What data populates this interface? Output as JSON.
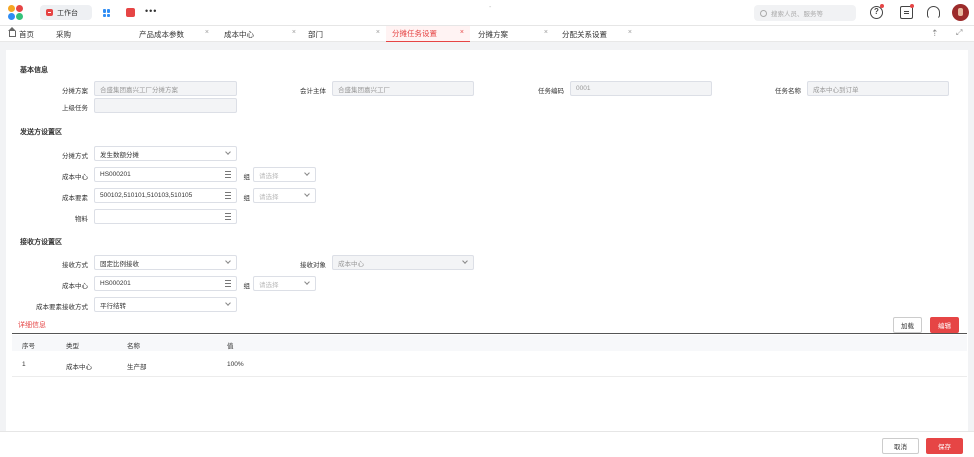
{
  "topbar": {
    "workbench_label": "工作台",
    "more_label": "•••",
    "center_mark": "-",
    "search_placeholder": "搜索人员、服务等"
  },
  "tabs": [
    {
      "label": "首页",
      "closable": false
    },
    {
      "label": "采购",
      "closable": false
    },
    {
      "label": "产品成本参数",
      "closable": true
    },
    {
      "label": "成本中心",
      "closable": true
    },
    {
      "label": "部门",
      "closable": true
    },
    {
      "label": "分摊任务设置",
      "closable": true,
      "active": true
    },
    {
      "label": "分摊方案",
      "closable": true
    },
    {
      "label": "分配关系设置",
      "closable": true
    }
  ],
  "basic": {
    "title": "基本信息",
    "scheme_label": "分摊方案",
    "scheme_value": "合盛集团嘉兴工厂分摊方案",
    "entity_label": "会计主体",
    "entity_value": "合盛集团嘉兴工厂",
    "code_label": "任务编码",
    "code_value": "0001",
    "name_label": "任务名称",
    "name_value": "成本中心到订单",
    "parent_label": "上级任务",
    "parent_value": ""
  },
  "sender": {
    "title": "发送方设置区",
    "method_label": "分摊方式",
    "method_value": "发生数额分摊",
    "cc_label": "成本中心",
    "cc_value": "HS000201",
    "cc_group_label": "组",
    "cc_group_placeholder": "请选择",
    "elem_label": "成本要素",
    "elem_value": "500102,510101,510103,510105",
    "elem_group_label": "组",
    "elem_group_placeholder": "请选择",
    "material_label": "物料",
    "material_value": ""
  },
  "receiver": {
    "title": "接收方设置区",
    "method_label": "接收方式",
    "method_value": "固定比例接收",
    "object_label": "接收对象",
    "object_value": "成本中心",
    "cc_label": "成本中心",
    "cc_value": "HS000201",
    "cc_group_label": "组",
    "cc_group_placeholder": "请选择",
    "elem_method_label": "成本要素接收方式",
    "elem_method_value": "平行结转"
  },
  "detail": {
    "tab_label": "详细信息",
    "load_label": "加载",
    "edit_label": "编辑",
    "columns": [
      "序号",
      "类型",
      "名称",
      "值"
    ],
    "rows": [
      [
        "1",
        "成本中心",
        "生产部",
        "100%"
      ]
    ]
  },
  "footer": {
    "cancel_label": "取消",
    "save_label": "保存"
  },
  "colors": {
    "accent": "#e64545",
    "brand_blue": "#2f8df4"
  }
}
